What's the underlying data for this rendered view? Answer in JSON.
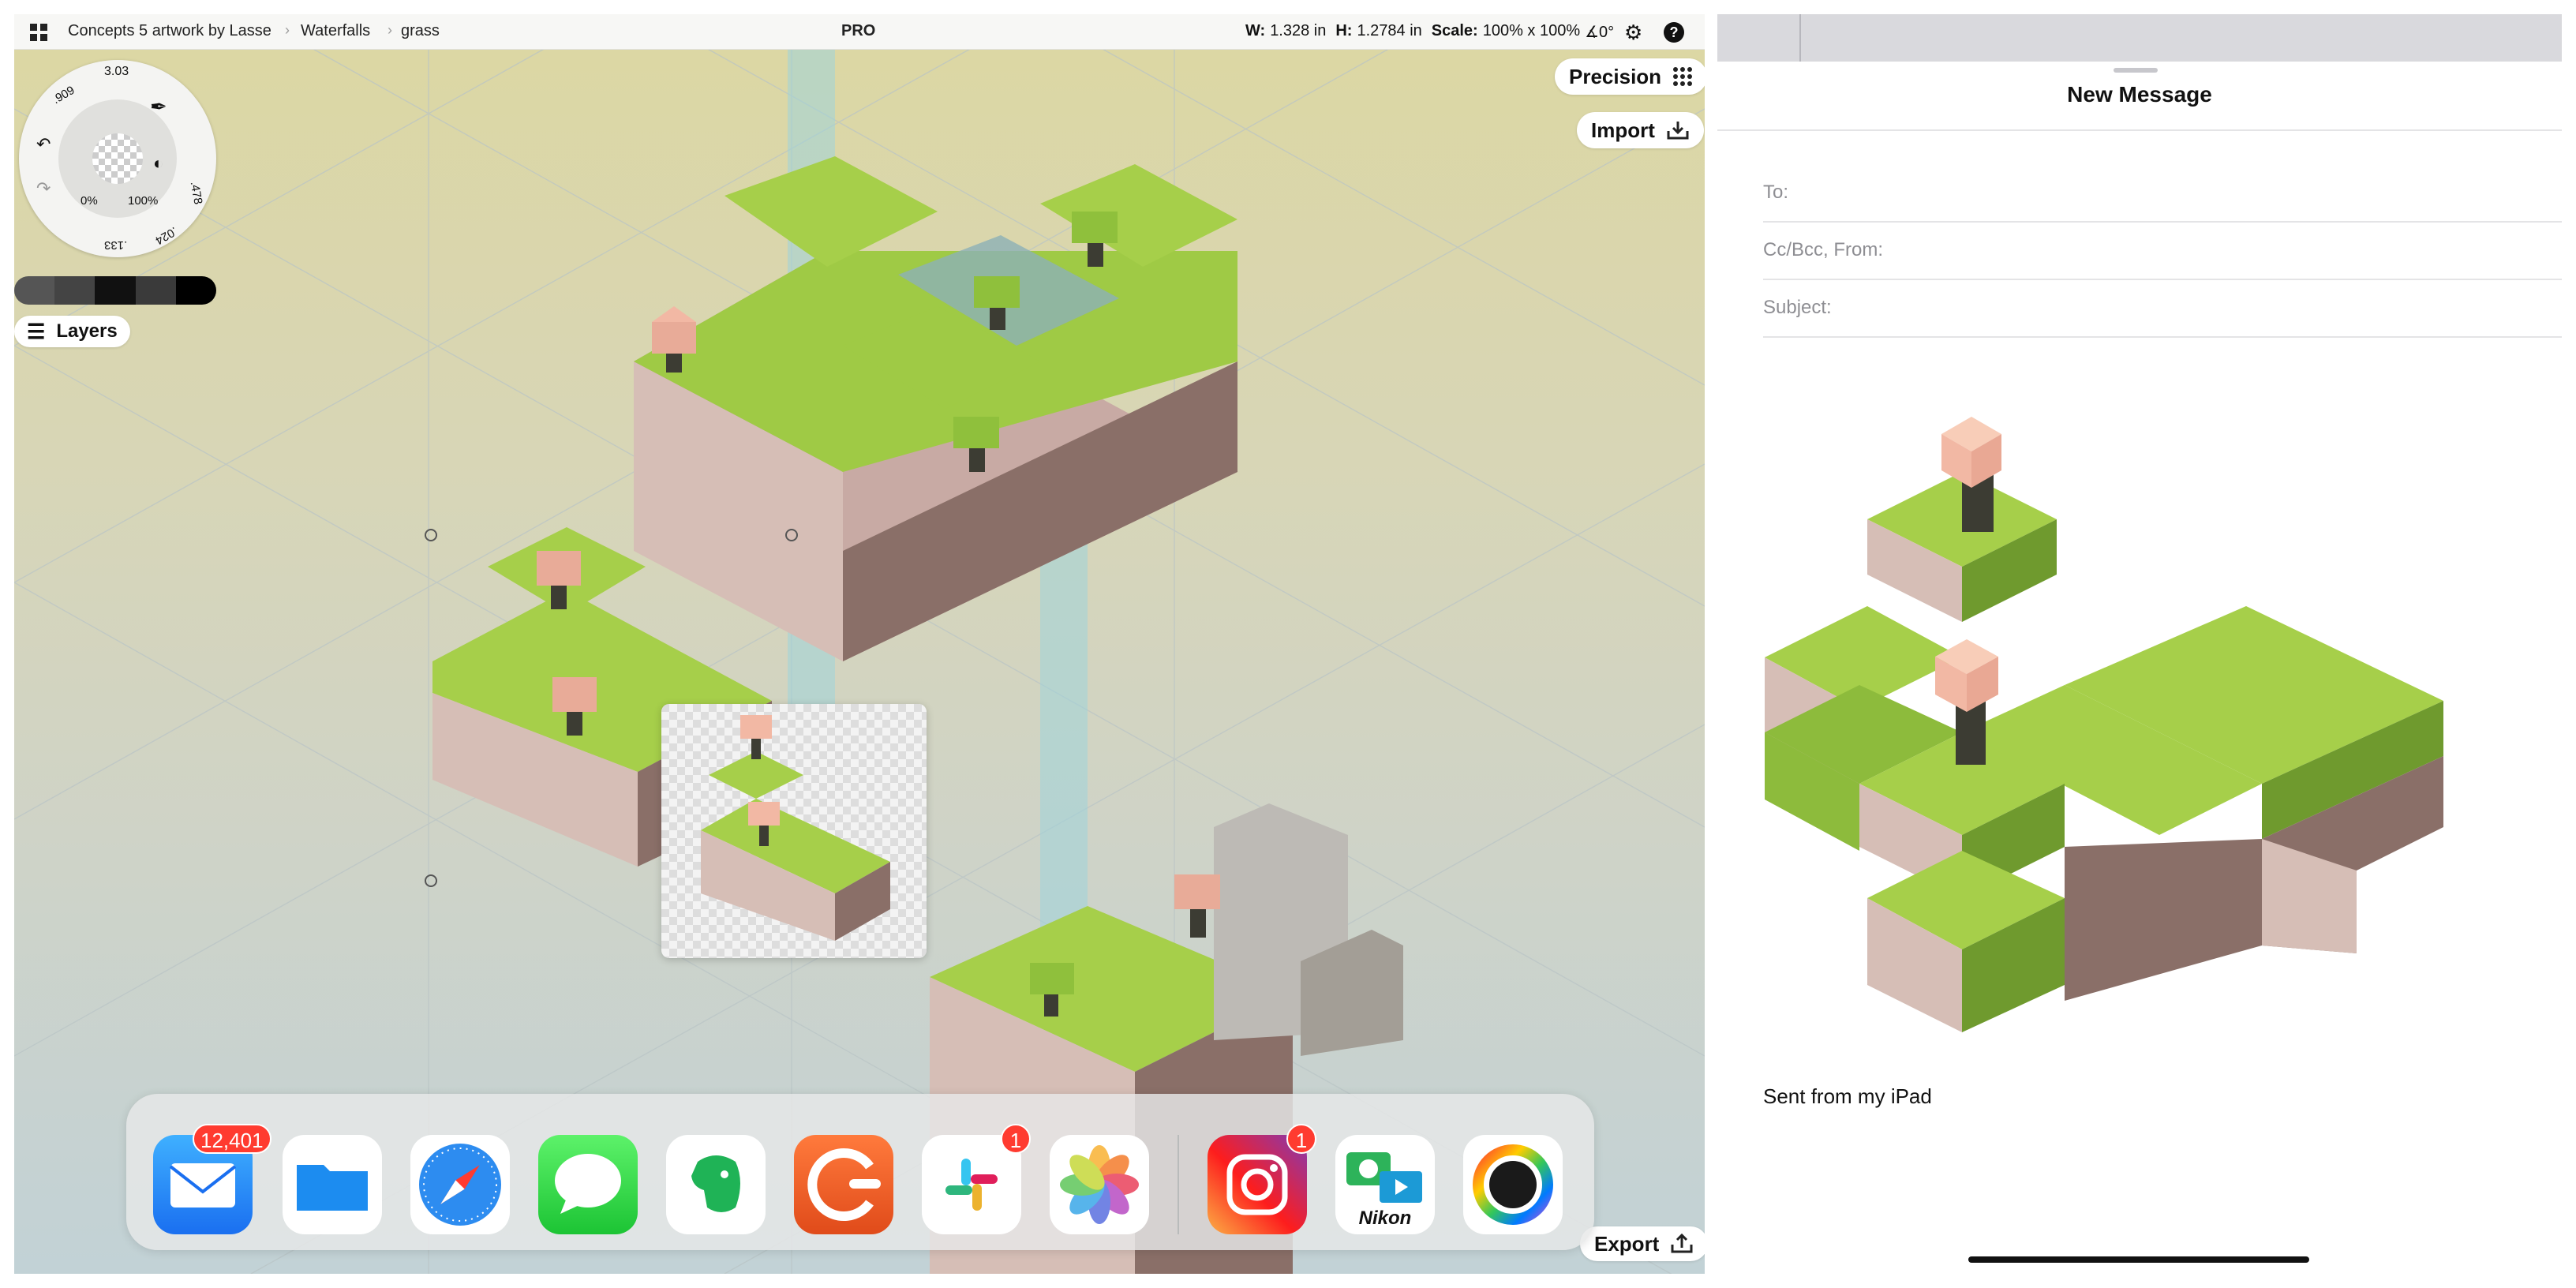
{
  "concepts": {
    "breadcrumbs": [
      "Concepts 5 artwork by Lasse",
      "Waterfalls",
      "grass"
    ],
    "pro_label": "PRO",
    "dimensions": {
      "w_label": "W:",
      "w_value": "1.328 in",
      "h_label": "H:",
      "h_value": "1.2784 in",
      "scale_label": "Scale:",
      "scale_value": "100% x 100%",
      "angle_value": "∡0°"
    },
    "tool_wheel": {
      "size_top": "3.03",
      "size_left": ".909",
      "size_right": ".478",
      "size_bottom_right": ".024",
      "size_bottom": ".133",
      "smoothing": "0%",
      "opacity": "100%"
    },
    "layers_label": "Layers",
    "precision_label": "Precision",
    "import_label": "Import",
    "export_label": "Export",
    "dock": [
      {
        "name": "mail-app-icon",
        "badge": "12,401"
      },
      {
        "name": "files-app-icon",
        "badge": ""
      },
      {
        "name": "safari-app-icon",
        "badge": ""
      },
      {
        "name": "messages-app-icon",
        "badge": ""
      },
      {
        "name": "evernote-app-icon",
        "badge": ""
      },
      {
        "name": "concepts-app-icon",
        "badge": ""
      },
      {
        "name": "slack-app-icon",
        "badge": "1"
      },
      {
        "name": "photos-app-icon",
        "badge": ""
      },
      {
        "name": "instagram-app-icon",
        "badge": "1"
      },
      {
        "name": "nikon-app-icon",
        "badge": "",
        "label": "Nikon"
      },
      {
        "name": "color-wheel-app-icon",
        "badge": ""
      }
    ]
  },
  "mail": {
    "title": "New Message",
    "to_label": "To:",
    "ccbcc_label": "Cc/Bcc, From:",
    "subject_label": "Subject:",
    "signature": "Sent from my iPad"
  },
  "colors": {
    "grass_top": "#a6cf4a",
    "grass_left": "#8dbb3c",
    "grass_right": "#6f9a2e",
    "dirt_left": "#d8c0b8",
    "dirt_right": "#8a6f68",
    "blossom": "#f2b8a4",
    "water": "#8ccfd8",
    "badge_red": "#ff3b30"
  }
}
